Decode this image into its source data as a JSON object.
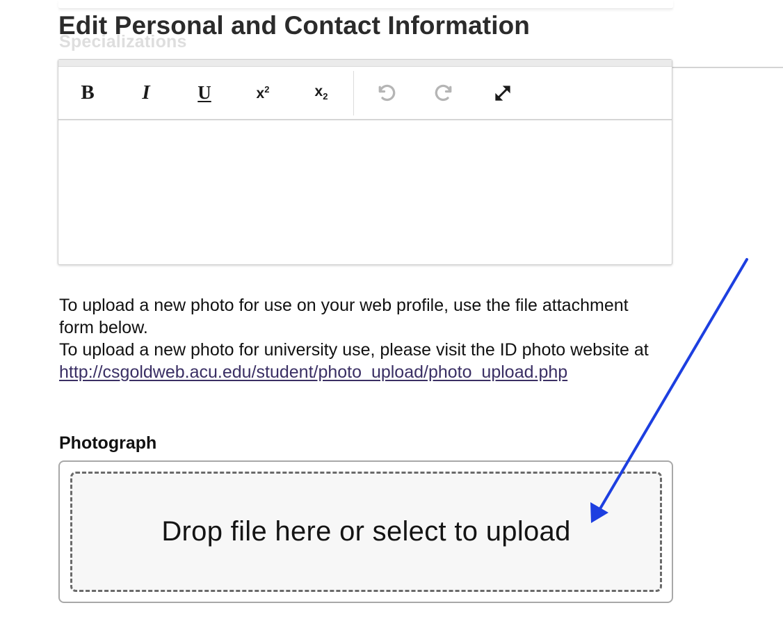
{
  "page": {
    "title": "Edit Personal and Contact Information",
    "ghost_label": "Specializations"
  },
  "editor": {
    "toolbar": [
      {
        "name": "bold",
        "glyph": "B"
      },
      {
        "name": "italic",
        "glyph": "I"
      },
      {
        "name": "underline",
        "glyph": "U"
      },
      {
        "name": "superscript",
        "glyph": "x",
        "script": "2"
      },
      {
        "name": "subscript",
        "glyph": "x",
        "script": "2"
      },
      {
        "name": "undo",
        "icon": "undo-icon",
        "state": "disabled"
      },
      {
        "name": "redo",
        "icon": "redo-icon",
        "state": "disabled"
      },
      {
        "name": "fullscreen",
        "icon": "expand-icon"
      }
    ],
    "content": ""
  },
  "info": {
    "line1": "To upload a new photo for use on your web profile, use the file attachment form below.",
    "line2": "To upload a new photo for university use, please visit the ID photo website at",
    "link": "http://csgoldweb.acu.edu/student/photo_upload/photo_upload.php"
  },
  "photo": {
    "label": "Photograph",
    "dropzone_text": "Drop file here or select to upload"
  },
  "annotation": {
    "arrow_color": "#1d3fe0"
  }
}
